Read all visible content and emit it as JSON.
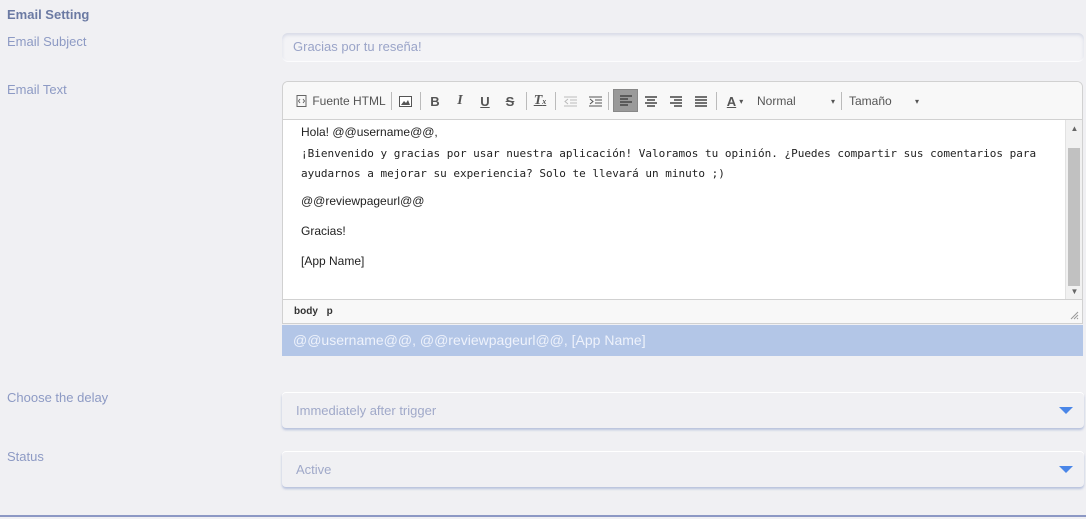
{
  "section_title": "Email Setting",
  "subject": {
    "label": "Email Subject",
    "value": "Gracias por tu reseña!"
  },
  "email_text": {
    "label": "Email Text",
    "toolbar": {
      "source_label": "Fuente HTML",
      "format_label": "Normal",
      "size_label": "Tamaño"
    },
    "body_lines": [
      "Hola! @@username@@,",
      "¡Bienvenido y gracias por usar nuestra aplicación! Valoramos tu opinión. ¿Puedes compartir sus comentarios para ayudarnos a mejorar su experiencia? Solo te llevará un minuto ;)",
      "@@reviewpageurl@@",
      "Gracias!",
      "[App Name]"
    ],
    "path": [
      "body",
      "p"
    ]
  },
  "placeholders": "@@username@@, @@reviewpageurl@@, [App Name]",
  "delay": {
    "label": "Choose the delay",
    "value": "Immediately after trigger"
  },
  "status": {
    "label": "Status",
    "value": "Active"
  },
  "colors": {
    "accent": "#4a86e8",
    "placeholders_bg": "#b3c6e7",
    "label": "#8d9ac4"
  }
}
